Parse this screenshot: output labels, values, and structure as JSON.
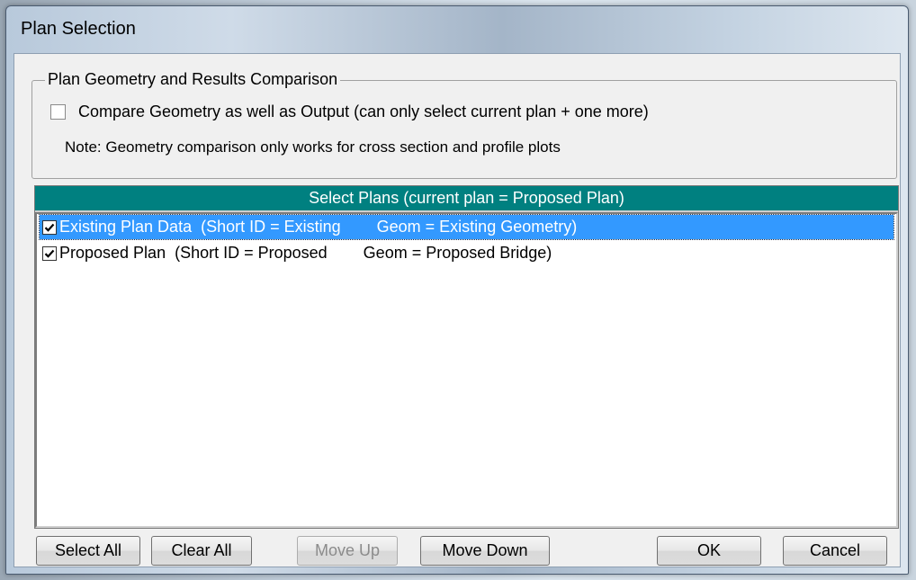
{
  "window": {
    "title": "Plan Selection"
  },
  "comparison_group": {
    "legend": "Plan Geometry and Results Comparison",
    "compare_checkbox_label": "Compare Geometry as well as Output (can only select current plan + one more)",
    "compare_checked": false,
    "note": "Note: Geometry comparison only works for cross section and profile plots"
  },
  "plans": {
    "header": "Select Plans  (current plan = Proposed Plan)",
    "items": [
      {
        "label": "Existing Plan Data  (Short ID = Existing        Geom = Existing Geometry)",
        "checked": true,
        "selected": true
      },
      {
        "label": "Proposed Plan  (Short ID = Proposed        Geom = Proposed Bridge)",
        "checked": true,
        "selected": false
      }
    ]
  },
  "buttons": {
    "select_all": "Select All",
    "clear_all": "Clear All",
    "move_up": "Move Up",
    "move_down": "Move Down",
    "ok": "OK",
    "cancel": "Cancel"
  },
  "colors": {
    "header_bg": "#008080",
    "selection_bg": "#3399ff"
  }
}
